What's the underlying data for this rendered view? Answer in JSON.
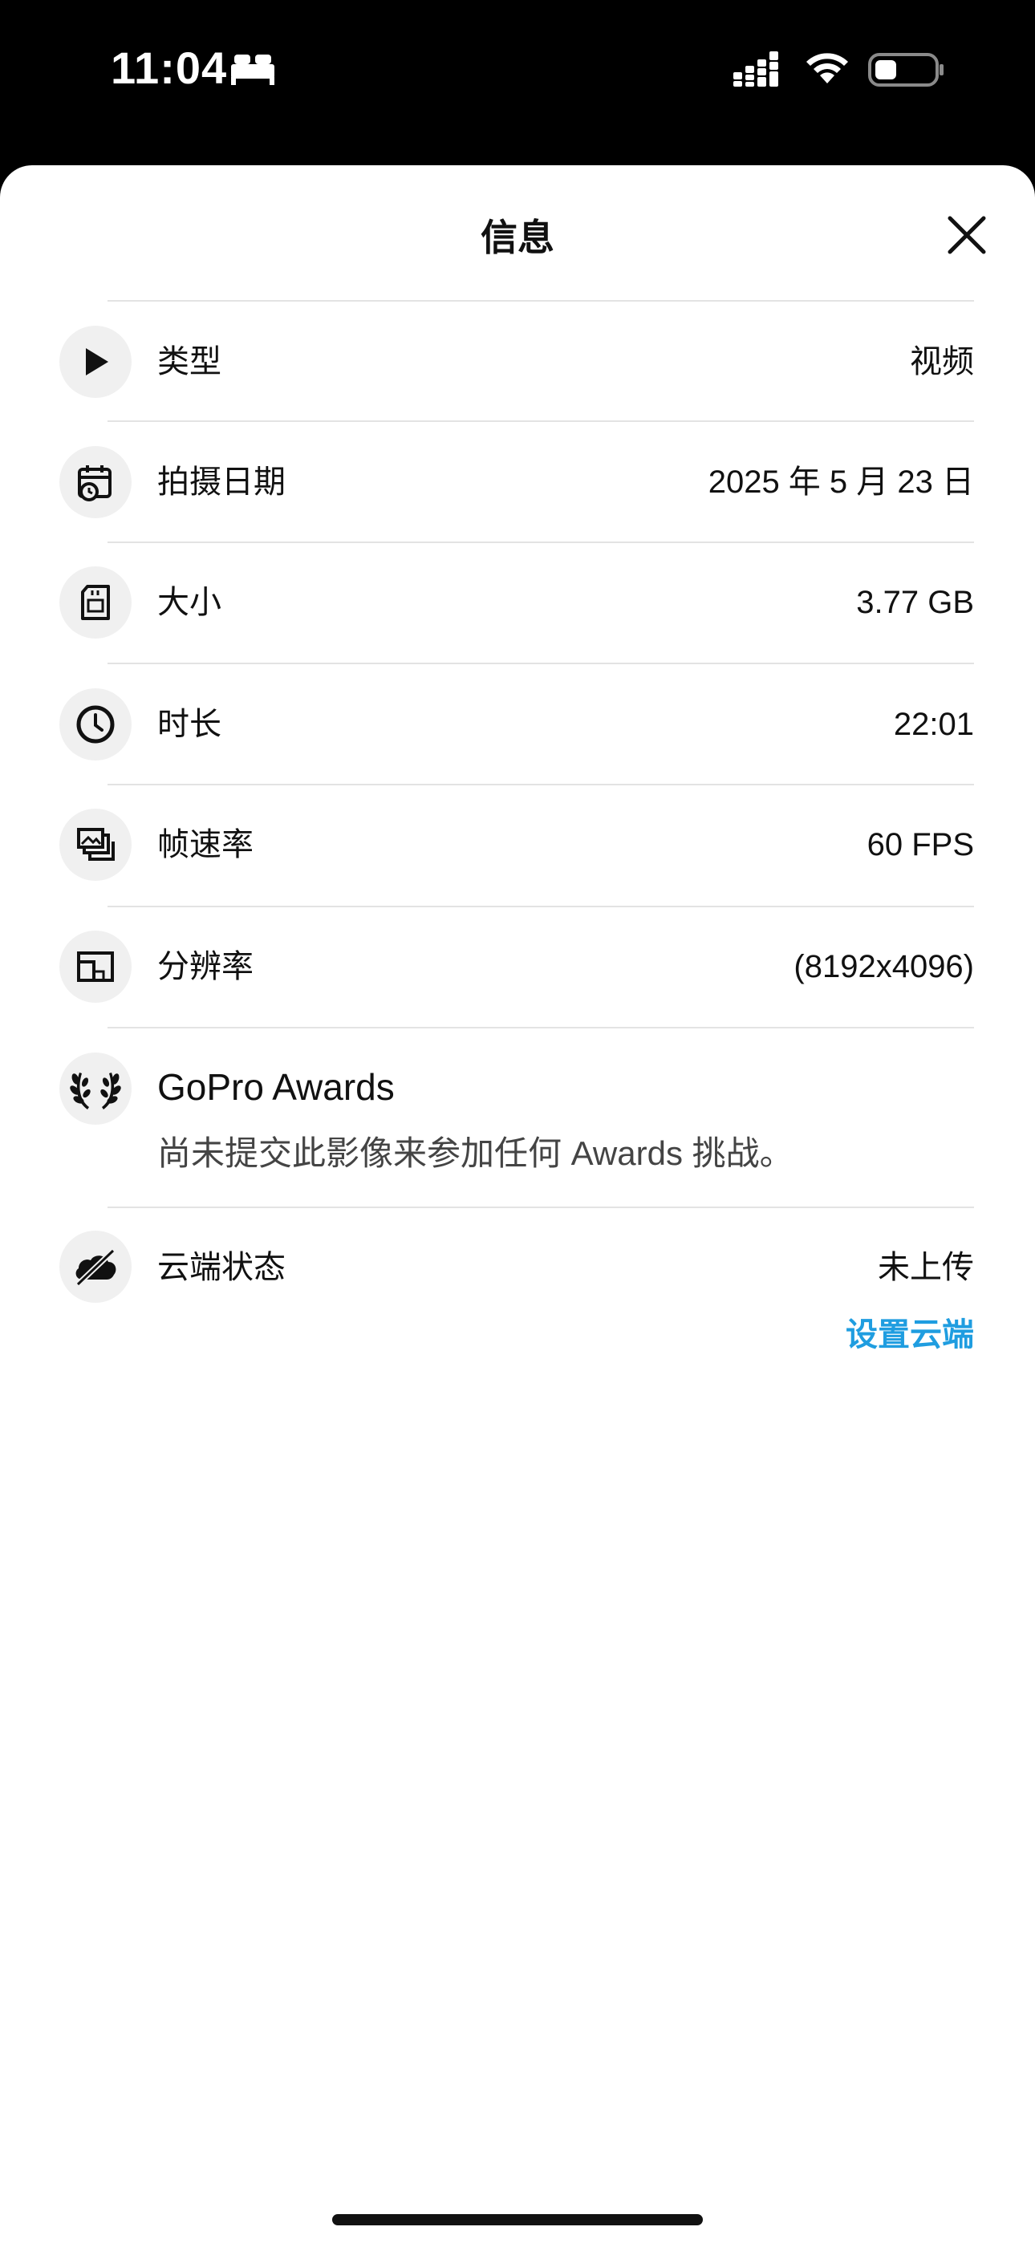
{
  "status_bar": {
    "time": "11:04"
  },
  "header": {
    "title": "信息"
  },
  "rows": [
    {
      "label": "类型",
      "value": "视频",
      "icon": "play-icon"
    },
    {
      "label": "拍摄日期",
      "value": "2025 年 5 月 23 日",
      "icon": "calendar-clock-icon"
    },
    {
      "label": "大小",
      "value": "3.77 GB",
      "icon": "sd-card-icon"
    },
    {
      "label": "时长",
      "value": "22:01",
      "icon": "clock-icon"
    },
    {
      "label": "帧速率",
      "value": "60 FPS",
      "icon": "frames-icon"
    },
    {
      "label": "分辨率",
      "value": "(8192x4096)",
      "icon": "resolution-icon"
    }
  ],
  "awards": {
    "title": "GoPro Awards",
    "description": "尚未提交此影像来参加任何 Awards 挑战。",
    "icon": "laurel-icon"
  },
  "cloud": {
    "label": "云端状态",
    "value": "未上传",
    "link": "设置云端",
    "icon": "cloud-off-icon",
    "link_color": "#1f9de0"
  }
}
